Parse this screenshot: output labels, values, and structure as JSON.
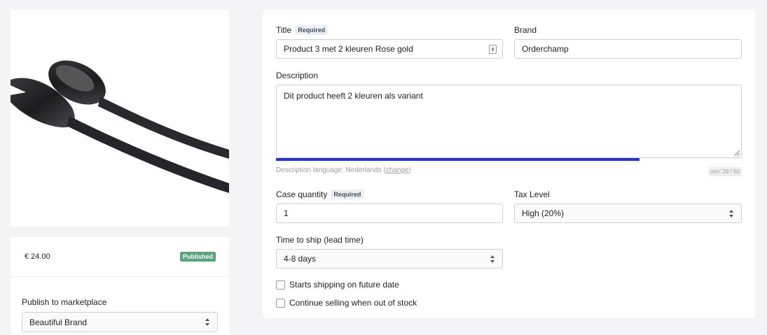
{
  "product": {
    "price": "€ 24.00",
    "status_badge": "Published"
  },
  "publish": {
    "label": "Publish to marketplace",
    "selected": "Beautiful Brand"
  },
  "form": {
    "title": {
      "label": "Title",
      "required_badge": "Required",
      "value": "Product 3 met 2 kleuren Rose gold"
    },
    "brand": {
      "label": "Brand",
      "value": "Orderchamp"
    },
    "description": {
      "label": "Description",
      "value": "Dit product heeft 2 kleuren als variant",
      "language_prefix": "Description language: Nederlands (",
      "language_link": "change",
      "language_suffix": ")",
      "counter": "min: 39 / 50",
      "progress": 0.78
    },
    "case_quantity": {
      "label": "Case quantity",
      "required_badge": "Required",
      "value": "1"
    },
    "tax_level": {
      "label": "Tax Level",
      "selected": "High (20%)"
    },
    "lead_time": {
      "label": "Time to ship (lead time)",
      "selected": "4-8 days"
    },
    "checkboxes": {
      "future_date": "Starts shipping on future date",
      "out_of_stock": "Continue selling when out of stock"
    }
  },
  "colors": {
    "accent": "#2533d8",
    "published": "#5aa37c"
  }
}
